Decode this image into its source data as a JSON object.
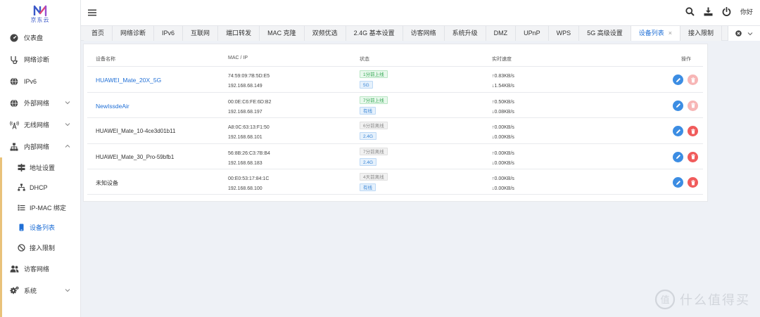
{
  "brand": {
    "logo_text": "京东云"
  },
  "sidebar": {
    "items": [
      {
        "label": "仪表盘",
        "icon": "dashboard-icon"
      },
      {
        "label": "网络诊断",
        "icon": "stethoscope-icon"
      },
      {
        "label": "IPv6",
        "icon": "globe-icon"
      },
      {
        "label": "外部网络",
        "icon": "globe-icon",
        "expandable": true
      },
      {
        "label": "无线网络",
        "icon": "wifi-tower-icon",
        "expandable": true
      },
      {
        "label": "内部网络",
        "icon": "sitemap-icon",
        "expandable": true,
        "expanded": true
      }
    ],
    "sub_items": [
      {
        "label": "地址设置",
        "icon": "signpost-icon"
      },
      {
        "label": "DHCP",
        "icon": "network-icon"
      },
      {
        "label": "IP-MAC 绑定",
        "icon": "list-icon"
      },
      {
        "label": "设备列表",
        "icon": "mobile-icon",
        "active": true
      },
      {
        "label": "接入限制",
        "icon": "ban-icon"
      }
    ],
    "bottom_items": [
      {
        "label": "访客网络",
        "icon": "users-icon"
      },
      {
        "label": "系统",
        "icon": "gears-icon",
        "expandable": true
      }
    ]
  },
  "topbar": {
    "greeting": "你好"
  },
  "tabs": [
    "首页",
    "网络诊断",
    "IPv6",
    "互联网",
    "端口转发",
    "MAC 克隆",
    "双频优选",
    "2.4G 基本设置",
    "访客网络",
    "系统升级",
    "DMZ",
    "UPnP",
    "WPS",
    "5G 高级设置",
    "设备列表",
    "接入限制"
  ],
  "active_tab": "设备列表",
  "table": {
    "headers": {
      "name": "设备名称",
      "mac_ip": "MAC / IP",
      "status": "状态",
      "speed": "实时速度",
      "ops": "操作"
    },
    "rows": [
      {
        "name": "HUAWEI_Mate_20X_5G",
        "link": true,
        "mac": "74:59:09:7B:5D:E5",
        "ip": "192.168.68.149",
        "status": "1分前上线",
        "status_type": "online",
        "band": "5G",
        "up": "↑0.83KB/s",
        "down": "↓1.54KB/s",
        "delete_disabled": true
      },
      {
        "name": "NewIssdeAir",
        "link": true,
        "mac": "00:0E:C6:FE:6D:B2",
        "ip": "192.168.68.197",
        "status": "7分前上线",
        "status_type": "online",
        "band": "有线",
        "up": "↑0.50KB/s",
        "down": "↓0.08KB/s",
        "delete_disabled": true
      },
      {
        "name": "HUAWEI_Mate_10-4ce3d01b11",
        "link": false,
        "mac": "A8:0C:63:13:F1:50",
        "ip": "192.168.68.101",
        "status": "6分前离线",
        "status_type": "offline",
        "band": "2.4G",
        "up": "↑0.00KB/s",
        "down": "↓0.00KB/s",
        "delete_disabled": false
      },
      {
        "name": "HUAWEI_Mate_30_Pro-59bfb1",
        "link": false,
        "mac": "56:8B:26:C3:7B:B4",
        "ip": "192.168.68.183",
        "status": "7分前离线",
        "status_type": "offline",
        "band": "2.4G",
        "up": "↑0.00KB/s",
        "down": "↓0.00KB/s",
        "delete_disabled": false
      },
      {
        "name": "未知设备",
        "link": false,
        "mac": "00:E0:53:17:84:1C",
        "ip": "192.168.68.100",
        "status": "4天前离线",
        "status_type": "offline",
        "band": "有线",
        "up": "↑0.00KB/s",
        "down": "↓0.00KB/s",
        "delete_disabled": false
      }
    ]
  },
  "watermark": {
    "text": "什么值得买"
  },
  "colors": {
    "accent": "#1f6fd6",
    "edit": "#3c8de3",
    "delete": "#f05b5b",
    "online": "#34a853"
  }
}
